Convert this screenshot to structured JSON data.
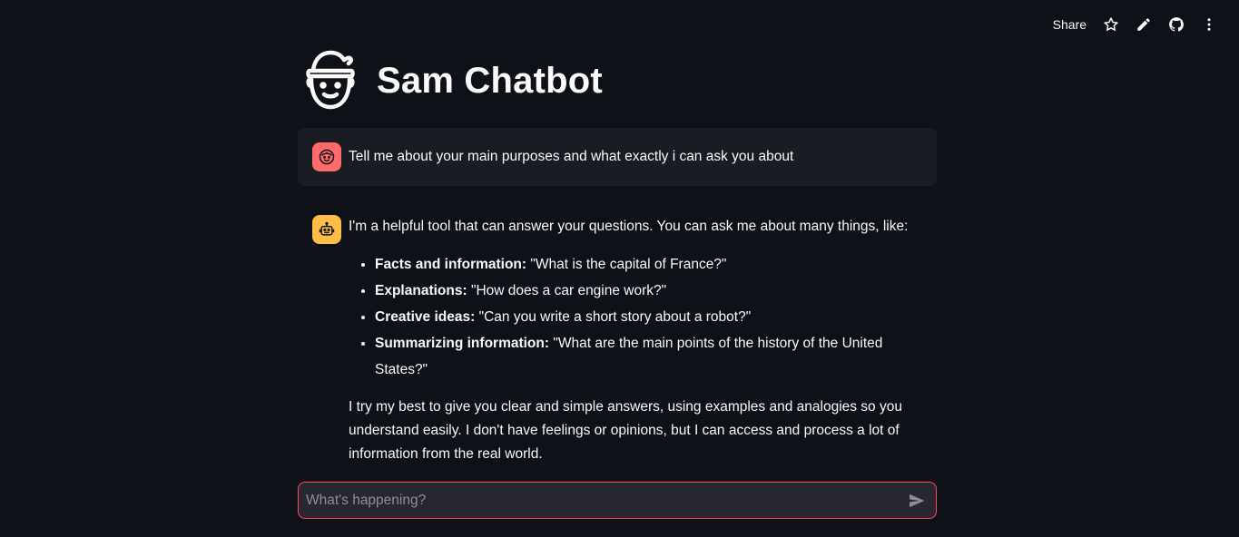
{
  "toolbar": {
    "share_label": "Share",
    "icons": [
      "star-icon",
      "pencil-icon",
      "github-icon",
      "more-vertical-icon"
    ]
  },
  "header": {
    "title": "Sam Chatbot",
    "logo_icon": "elf-face-icon"
  },
  "messages": {
    "user": {
      "avatar_icon": "smiley-face-icon",
      "avatar_color": "#ff6b6b",
      "text": "Tell me about your main purposes and what exactly i can ask you about"
    },
    "assistant": {
      "avatar_icon": "robot-icon",
      "avatar_color": "#ffbd45",
      "intro": "I'm a helpful tool that can answer your questions. You can ask me about many things, like:",
      "items": [
        {
          "label": "Facts and information:",
          "text": " \"What is the capital of France?\""
        },
        {
          "label": "Explanations:",
          "text": " \"How does a car engine work?\""
        },
        {
          "label": "Creative ideas:",
          "text": " \"Can you write a short story about a robot?\""
        },
        {
          "label": "Summarizing information:",
          "text": " \"What are the main points of the history of the United States?\""
        }
      ],
      "outro": "I try my best to give you clear and simple answers, using examples and analogies so you understand easily. I don't have feelings or opinions, but I can access and process a lot of information from the real world."
    }
  },
  "chat_input": {
    "value": "",
    "placeholder": "What's happening?",
    "border_color": "#ff4b4b",
    "send_icon": "send-icon"
  },
  "colors": {
    "background": "#0e1117",
    "user_message_bg": "#1a1c24",
    "input_bg": "#262730"
  }
}
